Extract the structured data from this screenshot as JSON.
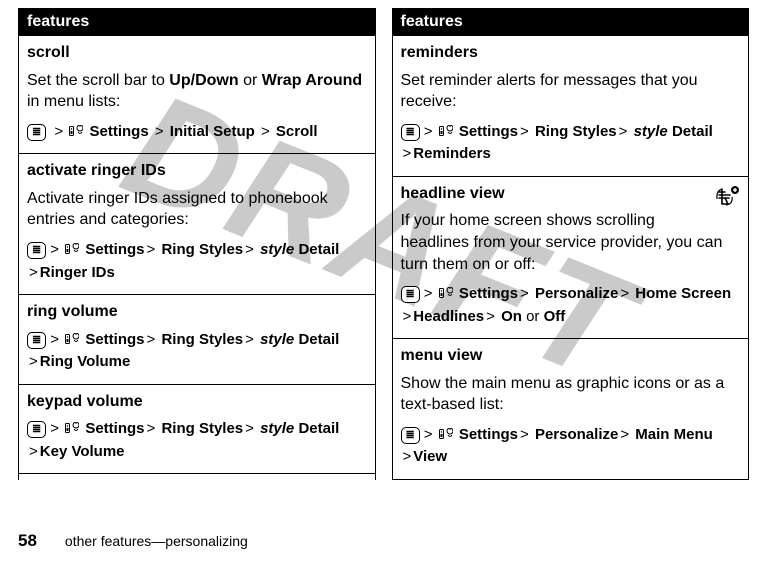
{
  "watermark": "DRAFT",
  "footer": {
    "page_number": "58",
    "text": "other features—personalizing"
  },
  "columns": [
    {
      "header": "features",
      "rows": [
        {
          "title": "scroll",
          "desc_pre": "Set the scroll bar to ",
          "desc_b1": "Up/Down",
          "desc_mid": " or ",
          "desc_b2": "Wrap Around",
          "desc_post": " in menu lists:",
          "seq": {
            "s1": "Settings",
            "s2": "Initial Setup",
            "s3": "Scroll"
          }
        },
        {
          "title": "activate ringer IDs",
          "desc": "Activate ringer IDs assigned to phonebook entries and categories:",
          "seq": {
            "s1": "Settings",
            "s2": "Ring Styles",
            "s3_style": "style",
            "s3_tail": " Detail",
            "s4": "Ringer IDs"
          }
        },
        {
          "title": "ring volume",
          "seq": {
            "s1": "Settings",
            "s2": "Ring Styles",
            "s3_style": "style",
            "s3_tail": " Detail",
            "s4": "Ring Volume"
          }
        },
        {
          "title": "keypad volume",
          "seq": {
            "s1": "Settings",
            "s2": "Ring Styles",
            "s3_style": "style",
            "s3_tail": " Detail",
            "s4": "Key Volume"
          }
        }
      ]
    },
    {
      "header": "features",
      "rows": [
        {
          "title": "reminders",
          "desc": "Set reminder alerts for messages that you receive:",
          "seq": {
            "s1": "Settings",
            "s2": "Ring Styles",
            "s3_style": "style",
            "s3_tail": " Detail",
            "s4": "Reminders"
          }
        },
        {
          "title": "headline view",
          "has_icon": true,
          "desc": "If your home screen shows scrolling headlines from your service provider, you can turn them on or off:",
          "seq": {
            "s1": "Settings",
            "s2": "Personalize",
            "s3": "Home Screen",
            "s4": "Headlines",
            "s5a": "On",
            "s5_join": " or ",
            "s5b": "Off"
          }
        },
        {
          "title": "menu view",
          "desc": "Show the main menu as graphic icons or as a text-based list:",
          "seq": {
            "s1": "Settings",
            "s2": "Personalize",
            "s3": "Main Menu",
            "s4": "View"
          }
        }
      ]
    }
  ]
}
